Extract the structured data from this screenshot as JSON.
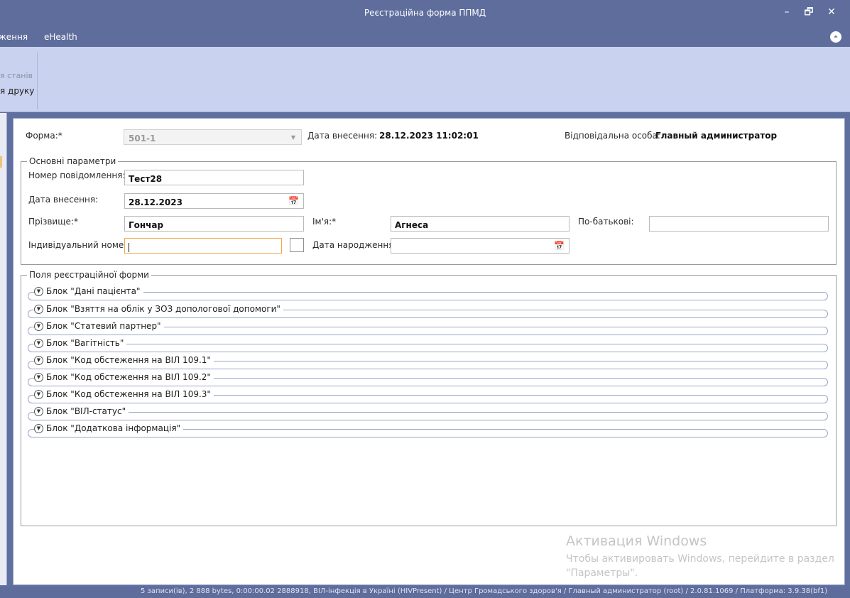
{
  "window": {
    "title": "Реєстраційна форма ППМД",
    "minimize": "–",
    "restore": "🗗",
    "close": "✕"
  },
  "menu": {
    "items": [
      "ження",
      "eHealth"
    ],
    "collapse_icon": "⏶"
  },
  "ribbon": {
    "item1": "я станів",
    "item2": "я друку"
  },
  "form": {
    "form_label": "Форма:*",
    "form_value": "501-1",
    "entry_date_label": "Дата внесення:",
    "entry_date_value": "28.12.2023 11:02:01",
    "responsible_label": "Відповідальна особа:",
    "responsible_value": "Главный администратор"
  },
  "main_params": {
    "legend": "Основні параметри",
    "message_no_label": "Номер повідомлення:*",
    "message_no_value": "Тест28",
    "date_label": "Дата внесення:",
    "date_value": "28.12.2023",
    "surname_label": "Прізвище:*",
    "surname_value": "Гончар",
    "name_label": "Ім'я:*",
    "name_value": "Агнеса",
    "patronymic_label": "По-батькові:",
    "patronymic_value": "",
    "id_label": "Індивідуальний номер:",
    "id_value": "",
    "birth_label": "Дата народження:",
    "birth_value": ""
  },
  "reg_fields": {
    "legend": "Поля реєстраційної форми",
    "blocks": [
      "Блок \"Дані пацієнта\"",
      "Блок \"Взяття на облік у ЗОЗ допологової допомоги\"",
      "Блок \"Статевий партнер\"",
      "Блок \"Вагітність\"",
      "Блок \"Код обстеження на ВІЛ 109.1\"",
      "Блок \"Код обстеження на ВІЛ 109.2\"",
      "Блок \"Код обстеження на ВІЛ 109.3\"",
      "Блок \"ВІЛ-статус\"",
      "Блок \"Додаткова інформація\""
    ]
  },
  "watermark": {
    "line1": "Активация Windows",
    "line2": "Чтобы активировать Windows, перейдите в раздел",
    "line3": "\"Параметры\"."
  },
  "status": {
    "text": "5 записи(ів), 2 888 bytes, 0:00:00.02 2888918, ВІЛ-інфекція в Україні (HIVPresent) / Центр Громадського здоров'я / Главный администратор (root) / 2.0.81.1069 / Платформа: 3.9.38(bf1)"
  },
  "colors": {
    "chrome": "#5e6d9c",
    "ribbon": "#c9d2ee",
    "focus_border": "#f0a84e"
  }
}
